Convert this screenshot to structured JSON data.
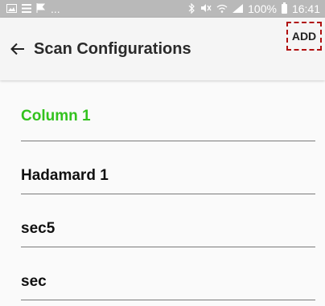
{
  "status_bar": {
    "left_icons": [
      "gallery-icon",
      "list-icon",
      "flag-icon"
    ],
    "ellipsis": "...",
    "battery": "100%",
    "time": "16:41"
  },
  "app_bar": {
    "title": "Scan Configurations",
    "action_label": "ADD"
  },
  "configurations": [
    {
      "label": "Column 1",
      "active": true
    },
    {
      "label": "Hadamard 1",
      "active": false
    },
    {
      "label": "sec5",
      "active": false
    },
    {
      "label": "sec",
      "active": false
    }
  ],
  "colors": {
    "active_item": "#33c21e",
    "status_bar": "#b9b9b9",
    "highlight_border": "#b01010"
  }
}
